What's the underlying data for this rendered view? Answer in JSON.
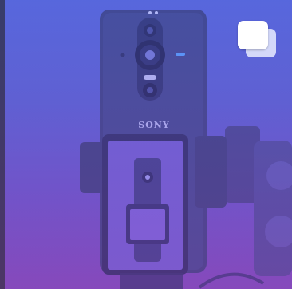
{
  "post": {
    "brand_text": "SONY",
    "multi_photo_icon": "multiple-photos-icon"
  }
}
